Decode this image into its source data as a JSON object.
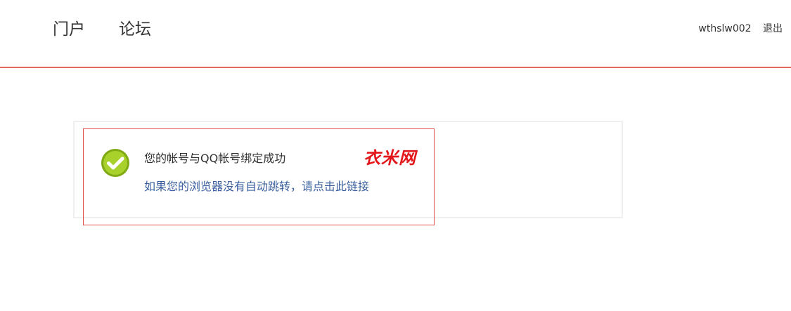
{
  "nav": {
    "portal": "门户",
    "forum": "论坛"
  },
  "user": {
    "username": "wthslw002",
    "logout": "退出"
  },
  "message": {
    "title": "您的帐号与QQ帐号绑定成功",
    "redirect_link": "如果您的浏览器没有自动跳转，请点击此链接",
    "icon": "check-circle-icon"
  },
  "watermark": {
    "text": "衣米网"
  },
  "colors": {
    "accent_line": "#e8675a",
    "success_green": "#8dc21f",
    "link_blue": "#3a5f9f",
    "watermark_red": "#e3161a",
    "frame_red": "#e24b4b"
  }
}
